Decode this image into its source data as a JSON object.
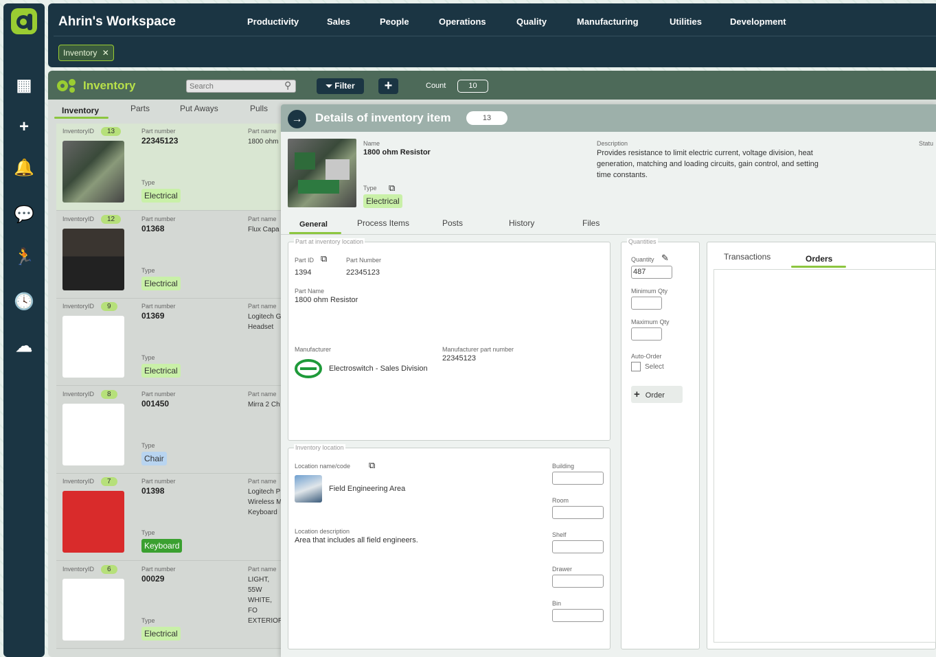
{
  "header": {
    "title": "Ahrin's Workspace",
    "nav": [
      "Productivity",
      "Sales",
      "People",
      "Operations",
      "Quality",
      "Manufacturing",
      "Utilities",
      "Development"
    ],
    "chip": "Inventory",
    "chip_close": "✕"
  },
  "sidebar": {
    "icons": [
      "apps-grid-icon",
      "add-icon",
      "bell-icon",
      "chat-icon",
      "runner-icon",
      "clock-icon",
      "cloud-upload-icon"
    ],
    "glyphs": [
      "▦",
      "+",
      "🔔",
      "💬",
      "🏃",
      "🕓",
      "☁"
    ]
  },
  "panel": {
    "title": "Inventory",
    "search_placeholder": "Search",
    "filter": "Filter",
    "add": "+",
    "count_label": "Count",
    "count_value": "10",
    "tabs": [
      "Inventory",
      "Parts",
      "Put Aways",
      "Pulls"
    ]
  },
  "items": [
    {
      "id_label": "InventoryID",
      "id": "13",
      "pn_label": "Part number",
      "pn": "22345123",
      "name_label": "Part name",
      "name": "1800 ohm",
      "type_label": "Type",
      "type": "Electrical"
    },
    {
      "id_label": "InventoryID",
      "id": "12",
      "pn_label": "Part number",
      "pn": "01368",
      "name_label": "Part name",
      "name": "Flux Capa",
      "type_label": "Type",
      "type": "Electrical"
    },
    {
      "id_label": "InventoryID",
      "id": "9",
      "pn_label": "Part number",
      "pn": "01369",
      "name_label": "Part name",
      "name": "Logitech G\nHeadset",
      "type_label": "Type",
      "type": "Electrical"
    },
    {
      "id_label": "InventoryID",
      "id": "8",
      "pn_label": "Part number",
      "pn": "001450",
      "name_label": "Part name",
      "name": "Mirra 2 Ch",
      "type_label": "Type",
      "type": "Chair"
    },
    {
      "id_label": "InventoryID",
      "id": "7",
      "pn_label": "Part number",
      "pn": "01398",
      "name_label": "Part name",
      "name": "Logitech P\nWireless M\nKeyboard",
      "type_label": "Type",
      "type": "Keyboard"
    },
    {
      "id_label": "InventoryID",
      "id": "6",
      "pn_label": "Part number",
      "pn": "00029",
      "name_label": "Part name",
      "name": "LIGHT, 55W\nWHITE, FO\nEXTERIOR",
      "type_label": "Type",
      "type": "Electrical"
    }
  ],
  "detail": {
    "title": "Details of inventory item",
    "id": "13",
    "name_label": "Name",
    "name": "1800 ohm Resistor",
    "type_label": "Type",
    "type": "Electrical",
    "desc_label": "Description",
    "desc": "Provides resistance to limit electric current, voltage division, heat generation, matching and loading circuits, gain control, and setting time constants.",
    "status_label": "Statu",
    "tabs": [
      "General",
      "Process Items",
      "Posts",
      "History",
      "Files"
    ],
    "part_section": "Part at inventory location",
    "part_id_label": "Part ID",
    "part_id": "1394",
    "part_number_label": "Part Number",
    "part_number": "22345123",
    "part_name_label": "Part Name",
    "part_name": "1800 ohm Resistor",
    "manufacturer_label": "Manufacturer",
    "manufacturer": "Electroswitch - Sales Division",
    "mfr_pn_label": "Manufacturer part number",
    "mfr_pn": "22345123",
    "loc_section": "Inventory location",
    "loc_label": "Location name/code",
    "loc": "Field Engineering Area",
    "loc_desc_label": "Location description",
    "loc_desc": "Area that includes all field engineers.",
    "loc_fields": [
      "Building",
      "Room",
      "Shelf",
      "Drawer",
      "Bin"
    ],
    "qty_section": "Quantities",
    "qty_label": "Quantity",
    "qty": "487",
    "min_label": "Minimum Qty",
    "max_label": "Maximum Qty",
    "auto_label": "Auto-Order",
    "auto_select": "Select",
    "order_btn": "Order",
    "right_tabs": [
      "Transactions",
      "Orders"
    ]
  }
}
